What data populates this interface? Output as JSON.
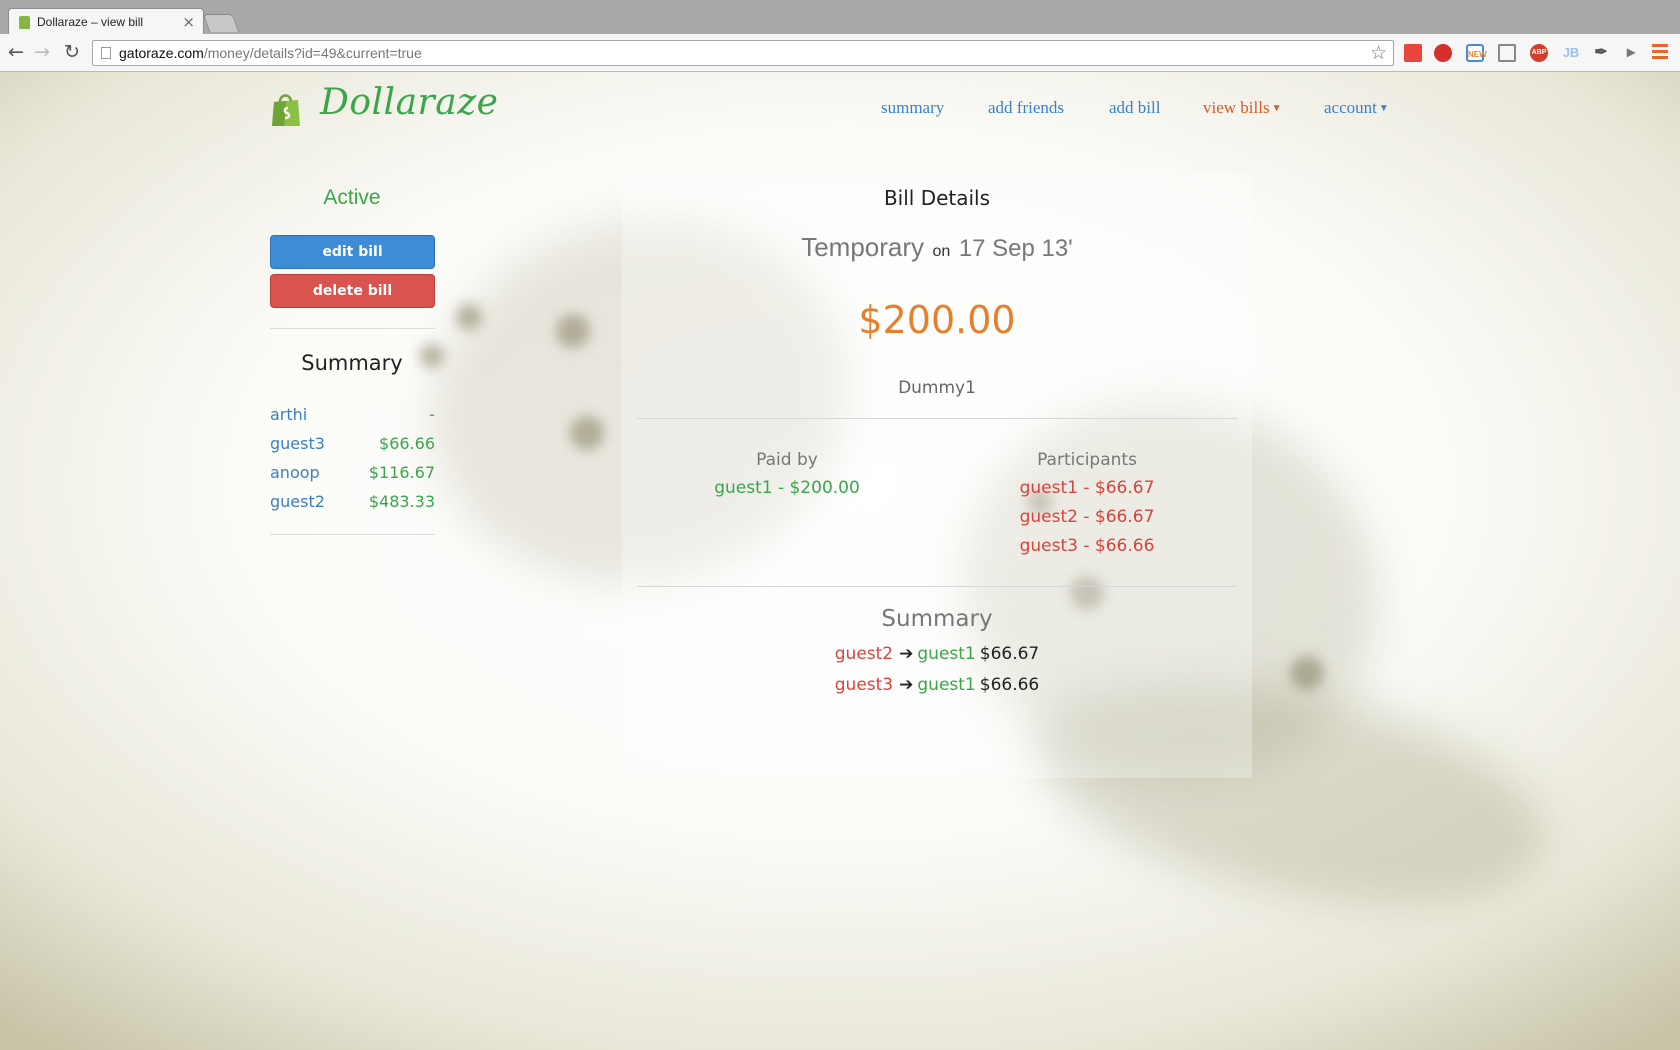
{
  "browser": {
    "tab_title": "Dollaraze – view bill",
    "tab_close": "×",
    "url_host": "gatoraze.com",
    "url_path": "/money/details?id=49&current=true",
    "ext_new_label": "NEW",
    "ext_abp_label": "ABP",
    "ext_jb_label": "JB"
  },
  "nav": {
    "brand": "Dollaraze",
    "links": {
      "summary": "summary",
      "add_friends": "add friends",
      "add_bill": "add bill",
      "view_bills": "view bills",
      "account": "account"
    },
    "active_color": "#d85b2a",
    "link_color": "#3b80c4"
  },
  "sidebar": {
    "status": "Active",
    "edit_button": "edit bill",
    "delete_button": "delete bill",
    "summary_heading": "Summary",
    "summary_rows": [
      {
        "name": "arthi",
        "amount": "-"
      },
      {
        "name": "guest3",
        "amount": "$66.66"
      },
      {
        "name": "anoop",
        "amount": "$116.67"
      },
      {
        "name": "guest2",
        "amount": "$483.33"
      }
    ]
  },
  "bill": {
    "heading": "Bill Details",
    "name": "Temporary",
    "on": "on",
    "date": "17 Sep 13'",
    "amount": "$200.00",
    "description": "Dummy1",
    "paid_by_heading": "Paid by",
    "paid_by": [
      "guest1 - $200.00"
    ],
    "participants_heading": "Participants",
    "participants": [
      "guest1 - $66.67",
      "guest2 - $66.67",
      "guest3 - $66.66"
    ],
    "summary_heading": "Summary",
    "settlements": [
      {
        "from": "guest2",
        "to": "guest1",
        "amount": "$66.67"
      },
      {
        "from": "guest3",
        "to": "guest1",
        "amount": "$66.66"
      }
    ]
  },
  "colors": {
    "green": "#3aa54a",
    "red": "#d9433d",
    "orange": "#e5812e",
    "blue": "#3b80c4",
    "edit_button": "#3f8cd6",
    "delete_button": "#d9534f"
  }
}
